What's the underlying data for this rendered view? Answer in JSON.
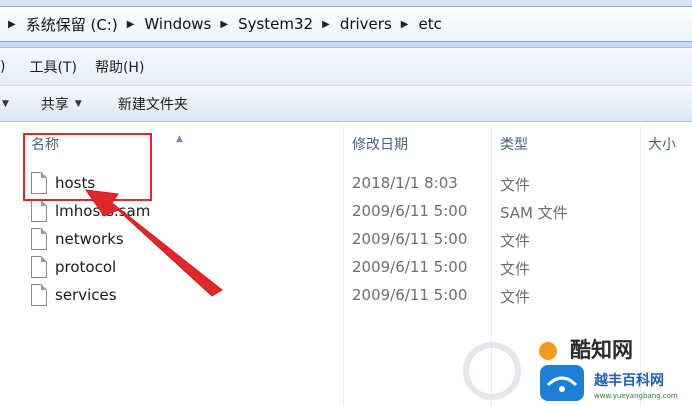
{
  "address": {
    "crumbs": [
      "系统保留 (C:)",
      "Windows",
      "System32",
      "drivers",
      "etc"
    ]
  },
  "menubar": {
    "items": [
      "工具(T)",
      "帮助(H)"
    ]
  },
  "toolbar": {
    "share_label": "共享",
    "new_folder_label": "新建文件夹"
  },
  "columns": {
    "name": "名称",
    "modified": "修改日期",
    "type": "类型",
    "size": "大小"
  },
  "files": [
    {
      "name": "hosts",
      "modified": "2018/1/1 8:03",
      "type": "文件"
    },
    {
      "name": "lmhosts.sam",
      "modified": "2009/6/11 5:00",
      "type": "SAM 文件"
    },
    {
      "name": "networks",
      "modified": "2009/6/11 5:00",
      "type": "文件"
    },
    {
      "name": "protocol",
      "modified": "2009/6/11 5:00",
      "type": "文件"
    },
    {
      "name": "services",
      "modified": "2009/6/11 5:00",
      "type": "文件"
    }
  ],
  "annotation": {
    "highlight_color": "#e0282b"
  },
  "watermark": {
    "brand": "酷知网",
    "brand2": "越丰百科网",
    "url": "www.yueyangbang.com"
  }
}
